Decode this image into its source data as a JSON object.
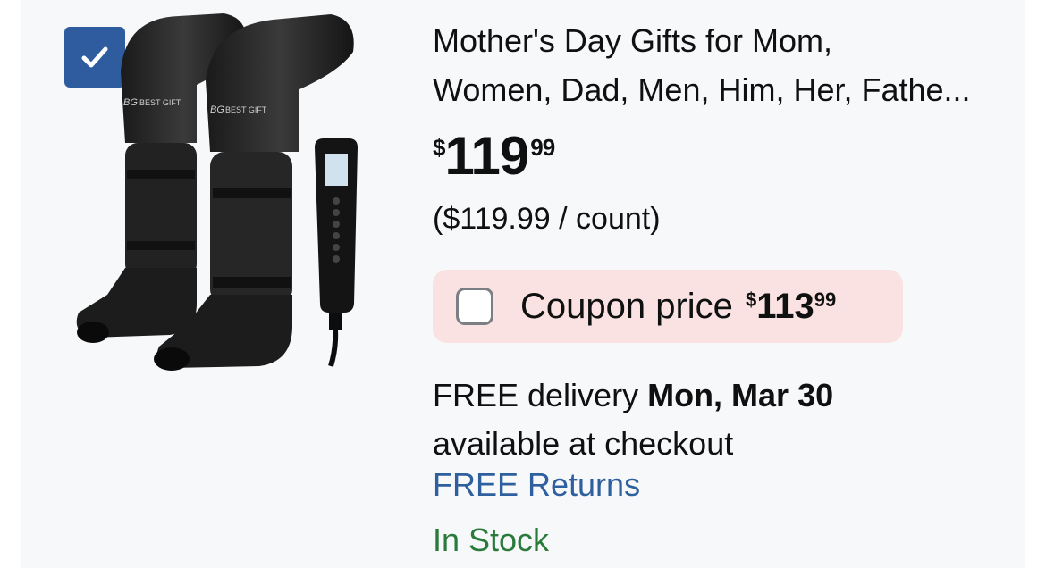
{
  "product": {
    "title_line1": "Mother's Day Gifts for Mom,",
    "title_line2": "Women, Dad, Men, Him, Her, Fathe...",
    "price": {
      "symbol": "$",
      "whole": "119",
      "fraction": "99"
    },
    "unit_price": "($119.99 / count)",
    "coupon": {
      "label": "Coupon price",
      "symbol": "$",
      "whole": "113",
      "fraction": "99"
    },
    "delivery_prefix": "FREE delivery ",
    "delivery_date": "Mon, Mar 30",
    "delivery_note": "available at checkout",
    "returns": "FREE Returns",
    "stock": "In Stock",
    "image_brand": "BEST GIFT",
    "image_logo": "BG"
  },
  "selection": {
    "checked": true
  },
  "colors": {
    "checkbox_blue": "#2f5c9f",
    "coupon_bg": "#fbe2e2",
    "link_blue": "#2e5f9e",
    "stock_green": "#2a7a3b"
  },
  "icons": {
    "select": "checkmark-icon"
  }
}
